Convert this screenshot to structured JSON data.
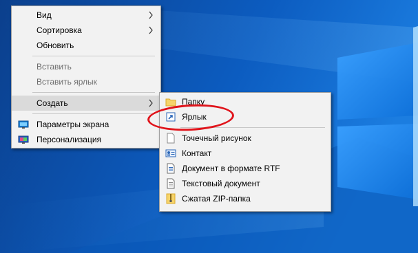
{
  "context_menu": {
    "items": [
      {
        "label": "Вид",
        "has_submenu": true
      },
      {
        "label": "Сортировка",
        "has_submenu": true
      },
      {
        "label": "Обновить"
      },
      {
        "label": "Вставить",
        "disabled": true
      },
      {
        "label": "Вставить ярлык",
        "disabled": true
      },
      {
        "label": "Создать",
        "has_submenu": true,
        "highlighted": true
      },
      {
        "label": "Параметры экрана",
        "icon": "display-settings-icon"
      },
      {
        "label": "Персонализация",
        "icon": "personalization-icon"
      }
    ]
  },
  "create_submenu": {
    "items": [
      {
        "label": "Папку",
        "icon": "folder-icon"
      },
      {
        "label": "Ярлык",
        "icon": "shortcut-icon"
      },
      {
        "label": "Точечный рисунок",
        "icon": "bitmap-file-icon"
      },
      {
        "label": "Контакт",
        "icon": "contact-icon"
      },
      {
        "label": "Документ в формате RTF",
        "icon": "rtf-document-icon"
      },
      {
        "label": "Текстовый документ",
        "icon": "text-document-icon"
      },
      {
        "label": "Сжатая ZIP-папка",
        "icon": "zip-folder-icon"
      }
    ]
  },
  "colors": {
    "desktop_background": "#0a4fa6",
    "menu_background": "#f2f2f2",
    "highlight": "#dadada",
    "annotation": "#e0141b"
  }
}
